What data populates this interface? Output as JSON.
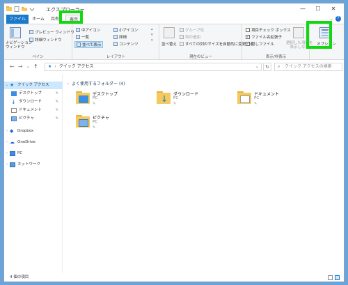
{
  "window": {
    "title": "エクスプローラー",
    "controls": {
      "minimize": "—",
      "maximize": "☐",
      "close": "✕"
    }
  },
  "ribbon_tabs": [
    "ファイル",
    "ホーム",
    "共有",
    "表示"
  ],
  "ribbon": {
    "panes": {
      "label": "ペイン",
      "nav_pane": "ナビゲーション\nウィンドウ",
      "preview_pane": "プレビュー ウィンドウ",
      "details_pane": "詳細ウィンドウ"
    },
    "layout": {
      "label": "レイアウト",
      "medium_icons": "中アイコン",
      "small_icons": "小アイコン",
      "list": "一覧",
      "details": "詳細",
      "tiles": "並べて表示",
      "content": "コンテンツ"
    },
    "current_view": {
      "label": "現在のビュー",
      "sort": "並べ替え",
      "group_by": "グループ化",
      "add_columns": "列の追加",
      "size_all_columns": "すべての列のサイズを自動的に変更する"
    },
    "show_hide": {
      "label": "表示/非表示",
      "item_checkboxes": "項目チェック ボックス",
      "file_extensions": "ファイル名拡張子",
      "hidden_items": "隠しファイル",
      "hide_selected": "選択した項目を\n表示しない"
    },
    "options": {
      "label": "オプション"
    }
  },
  "address_bar": {
    "path": "クイック アクセス",
    "search_placeholder": "クイック アクセスの検索"
  },
  "nav_pane": {
    "quick_access": "クイック アクセス",
    "pinned": [
      "デスクトップ",
      "ダウンロード",
      "ドキュメント",
      "ピクチャ"
    ],
    "roots": [
      "Dropbox",
      "OneDrive",
      "PC",
      "ネットワーク"
    ]
  },
  "content": {
    "section_header": "よく使用するフォルダー (4)",
    "folders": [
      {
        "name": "デスクトップ",
        "location": "PC"
      },
      {
        "name": "ダウンロード",
        "location": "PC"
      },
      {
        "name": "ドキュメント",
        "location": "PC"
      },
      {
        "name": "ピクチャ",
        "location": "PC"
      }
    ]
  },
  "status_bar": {
    "item_count": "4 個の項目"
  },
  "colors": {
    "accent": "#1979ca",
    "highlight_box": "#12d812",
    "selection": "#cce8ff",
    "folder": "#f4c95d"
  },
  "icons": {
    "desktop": "desktop-folder-icon",
    "downloads": "download-folder-icon",
    "documents": "documents-folder-icon",
    "pictures": "pictures-folder-icon",
    "pin": "pin-icon"
  }
}
